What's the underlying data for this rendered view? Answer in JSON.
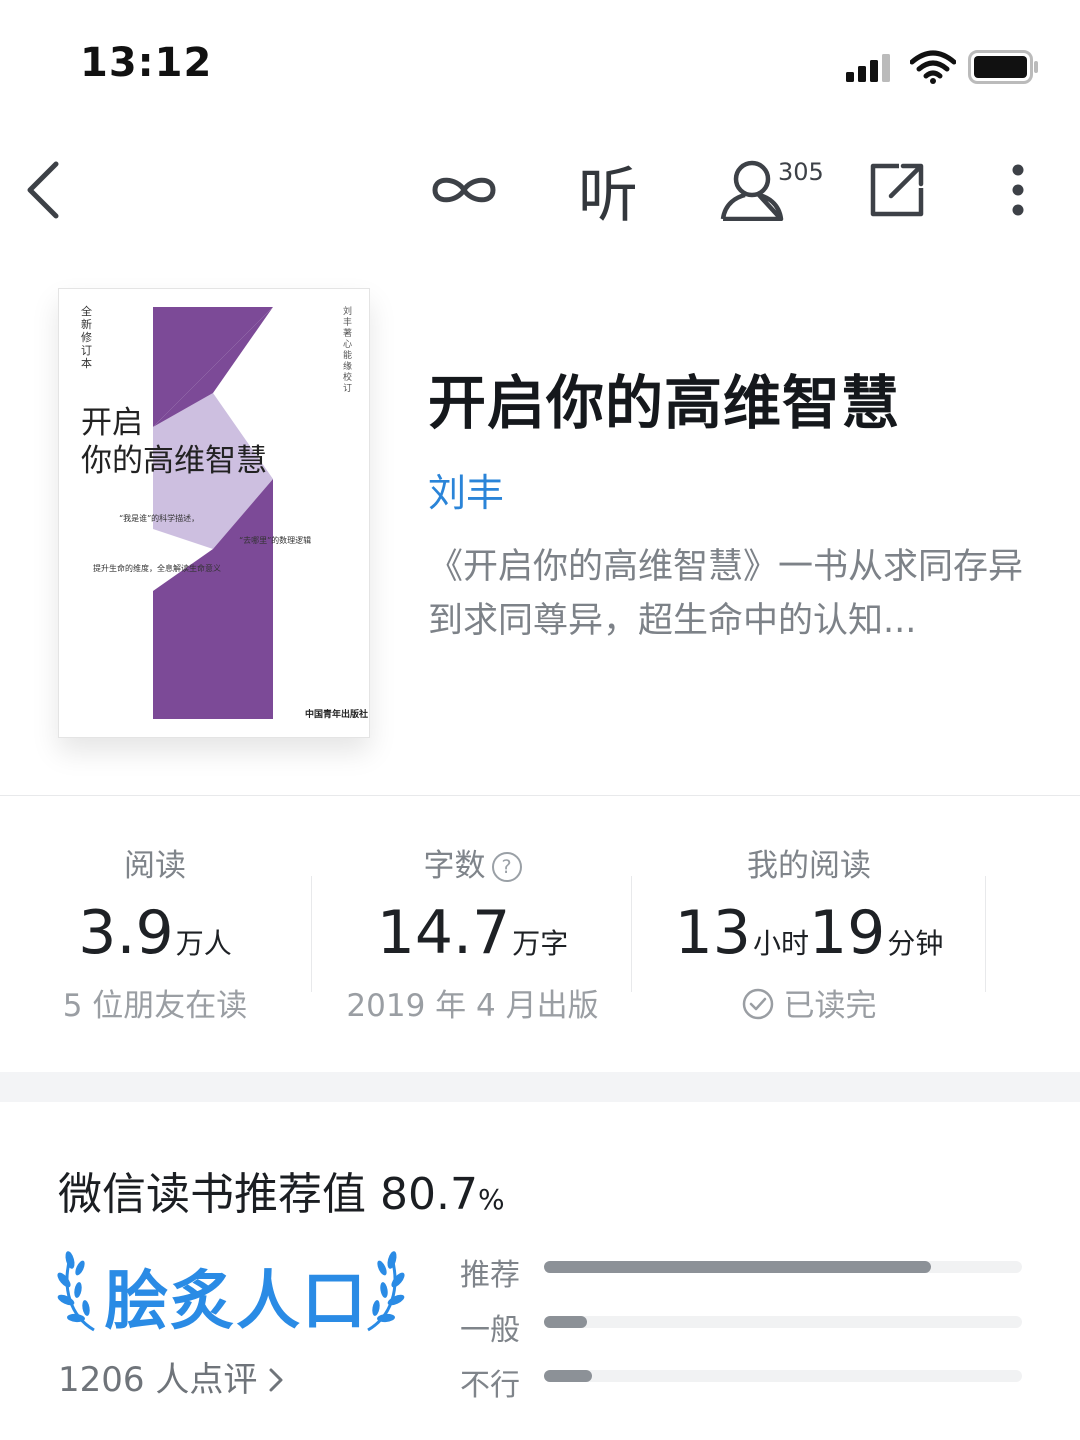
{
  "status_bar": {
    "time": "13:12"
  },
  "nav": {
    "listen_label": "听",
    "friends_count": "305"
  },
  "cover": {
    "edition": "全新修订本",
    "title_line1": "开启",
    "title_line2": "你的高维智慧",
    "author_vertical": "刘丰著 心能缘 校订",
    "line1": "“我是谁”的科学描述，",
    "line2": "“去哪里”的数理逻辑",
    "line3": "提升生命的维度，全息解读生命意义",
    "publisher": "中国青年出版社",
    "colors": {
      "purple": "#7c4a97",
      "lavender": "#cdbfe0"
    }
  },
  "book": {
    "title": "开启你的高维智慧",
    "author": "刘丰",
    "description": "《开启你的高维智慧》一书从求同存异到求同尊异，超生命中的认知..."
  },
  "stats": {
    "reads": {
      "label": "阅读",
      "value": "3.9",
      "unit": "万人",
      "sub": "5 位朋友在读"
    },
    "words": {
      "label": "字数",
      "value": "14.7",
      "unit": "万字",
      "sub": "2019 年 4 月出版"
    },
    "my_reading": {
      "label": "我的阅读",
      "hours": "13",
      "hours_unit": "小时",
      "minutes": "19",
      "minutes_unit": "分钟",
      "sub": "已读完"
    }
  },
  "rating": {
    "title": "微信读书推荐值 80.7",
    "percent_sign": "%",
    "badge": "脍炙人口",
    "reviews": "1206 人点评",
    "bars": [
      {
        "label": "推荐",
        "fraction": 0.81
      },
      {
        "label": "一般",
        "fraction": 0.09
      },
      {
        "label": "不行",
        "fraction": 0.1
      }
    ],
    "colors": {
      "badge": "#2a8be5",
      "bar": "#8c9197",
      "track": "#f1f2f3"
    }
  }
}
